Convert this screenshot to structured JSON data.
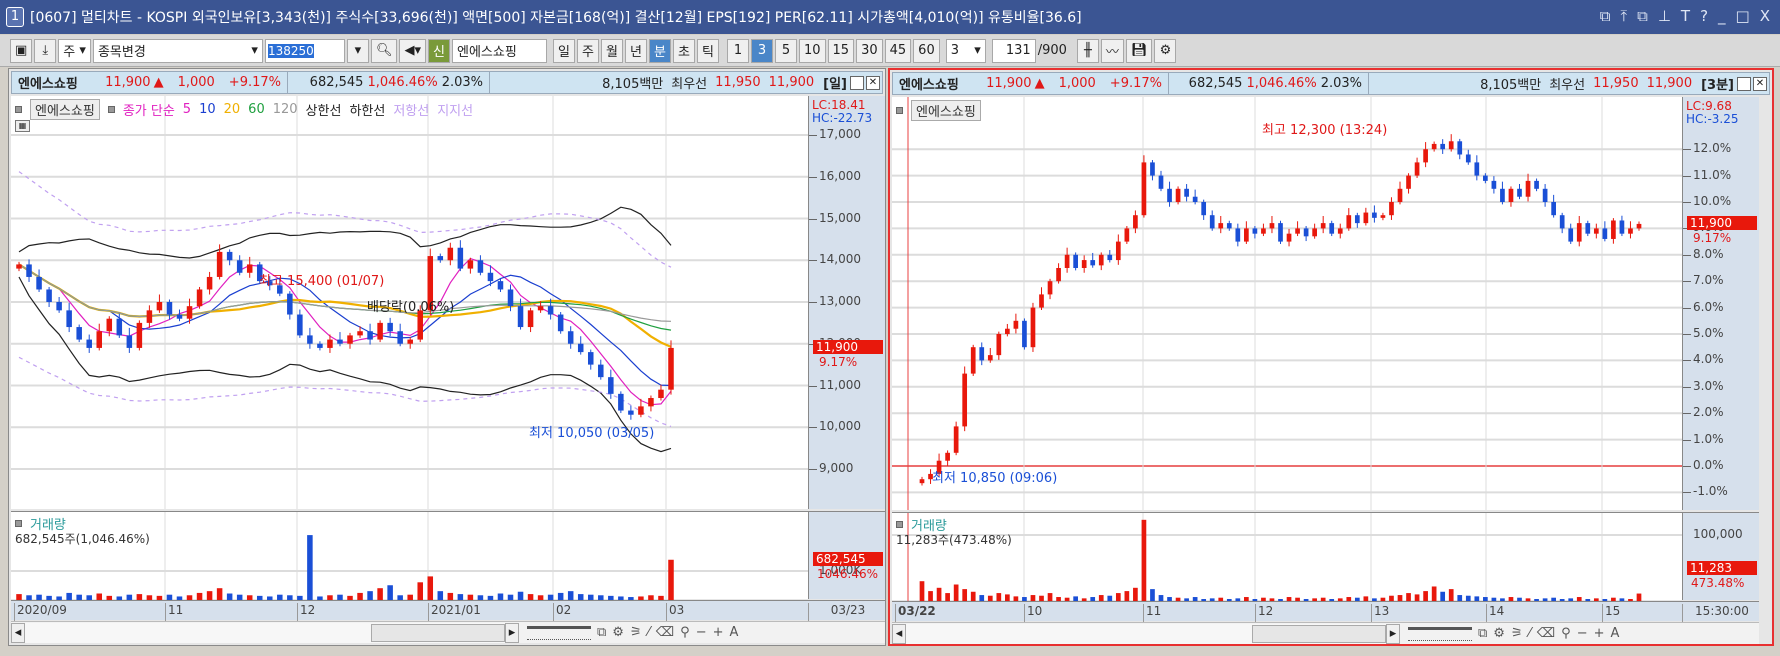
{
  "window": {
    "number": "1",
    "title": "[0607] 멀티차트 - KOSPI 외국인보유[3,343(천)] 주식수[33,696(천)] 액면[500] 자본금[168(억)] 결산[12월] EPS[192] PER[62.11] 시가총액[4,010(억)] 유통비율[36.6]",
    "controls": [
      "⧉",
      "⤒",
      "⧉",
      "⊥",
      "T",
      "?",
      "_",
      "□",
      "X"
    ]
  },
  "toolbar": {
    "market": "주",
    "stock_change": "종목변경",
    "code": "138250",
    "badge": "신",
    "stock_name": "엔에스쇼핑",
    "periods": [
      "일",
      "주",
      "월",
      "년",
      "분",
      "초",
      "틱"
    ],
    "active_period": "분",
    "intervals": [
      "1",
      "3",
      "5",
      "10",
      "15",
      "30",
      "45",
      "60"
    ],
    "active_interval": "3",
    "count_select": "3",
    "display_count": "131",
    "total": "/900"
  },
  "colors": {
    "up": "#e8180c",
    "down": "#1a4fd6",
    "title_bar": "#3b5593",
    "axis_bg": "#d6e0ec"
  },
  "left": {
    "info": {
      "name": "엔에스쇼핑",
      "price": "11,900",
      "arrow": "▲",
      "change": "1,000",
      "change_pct": "+9.17%",
      "volume": "682,545",
      "volume_pct": "1,046.46%",
      "turnover": "2.03%",
      "amount": "8,105백만",
      "best_label": "최우선",
      "ask": "11,950",
      "bid": "11,900",
      "period": "[일]"
    },
    "legend": {
      "stock": "엔에스쇼핑",
      "items": [
        {
          "t": "종가 단순",
          "c": "#e020c0"
        },
        {
          "t": "5",
          "c": "#e020c0"
        },
        {
          "t": "10",
          "c": "#1a3fd0"
        },
        {
          "t": "20",
          "c": "#f0b000"
        },
        {
          "t": "60",
          "c": "#20a040"
        },
        {
          "t": "120",
          "c": "#999999"
        },
        {
          "t": "상한선",
          "c": "#222222"
        },
        {
          "t": "하한선",
          "c": "#222222"
        },
        {
          "t": "저항선",
          "c": "#c0a0f0"
        },
        {
          "t": "지지선",
          "c": "#c0a0f0"
        }
      ]
    },
    "lc": "LC:18.41",
    "hc": "HC:-22.73",
    "y_ticks": [
      "17,000",
      "16,000",
      "15,000",
      "14,000",
      "13,000",
      "12,000",
      "11,000",
      "10,000",
      "9,000"
    ],
    "last_price": "11,900",
    "last_pct": "9.17%",
    "annotations": {
      "high": "최고 15,400 (01/07)",
      "low": "최저 10,050 (03/05)",
      "dividend": "배당락(0.06%)"
    },
    "volume": {
      "title": "거래량",
      "summary": "682,545주(1,046.46%)",
      "tick": "1,000K",
      "last": "682,545",
      "last_pct": "1046.46%"
    },
    "x_labels": [
      "2020/09",
      "11",
      "12",
      "2021/01",
      "02",
      "03"
    ],
    "x_last": "03/23",
    "closes": [
      13900,
      13600,
      13300,
      13000,
      12800,
      12400,
      12100,
      11900,
      12300,
      12600,
      12200,
      11900,
      12500,
      12800,
      13000,
      12700,
      12600,
      12900,
      13300,
      13600,
      14200,
      14000,
      13700,
      13900,
      13500,
      13400,
      13200,
      12700,
      12200,
      12000,
      11900,
      12100,
      12000,
      12200,
      12300,
      12100,
      12500,
      12300,
      12000,
      12100,
      12800,
      14100,
      14000,
      14300,
      13800,
      14000,
      13700,
      13500,
      13300,
      12900,
      12400,
      12800,
      12900,
      12700,
      12300,
      12000,
      11800,
      11500,
      11200,
      10800,
      10400,
      10300,
      10500,
      10700,
      10900,
      11900
    ],
    "volumes_k": [
      100,
      80,
      90,
      70,
      60,
      120,
      90,
      80,
      110,
      70,
      60,
      90,
      100,
      80,
      70,
      90,
      60,
      80,
      120,
      150,
      200,
      110,
      90,
      80,
      70,
      60,
      90,
      80,
      70,
      1100,
      60,
      80,
      90,
      70,
      120,
      150,
      200,
      250,
      80,
      90,
      300,
      400,
      150,
      120,
      100,
      90,
      80,
      70,
      110,
      90,
      140,
      100,
      80,
      90,
      120,
      150,
      100,
      90,
      80,
      70,
      60,
      50,
      60,
      80,
      70,
      682
    ]
  },
  "right": {
    "info": {
      "name": "엔에스쇼핑",
      "price": "11,900",
      "arrow": "▲",
      "change": "1,000",
      "change_pct": "+9.17%",
      "volume": "682,545",
      "volume_pct": "1,046.46%",
      "turnover": "2.03%",
      "amount": "8,105백만",
      "best_label": "최우선",
      "ask": "11,950",
      "bid": "11,900",
      "period": "[3분]"
    },
    "legend": {
      "stock": "엔에스쇼핑"
    },
    "lc": "LC:9.68",
    "hc": "HC:-3.25",
    "y_ticks": [
      "12.0%",
      "11.0%",
      "10.0%",
      "9.0%",
      "8.0%",
      "7.0%",
      "6.0%",
      "5.0%",
      "4.0%",
      "3.0%",
      "2.0%",
      "1.0%",
      "0.0%",
      "-1.0%"
    ],
    "last_price": "11,900",
    "last_pct": "9.17%",
    "annotations": {
      "high": "최고 12,300 (13:24)",
      "low": "최저 10,850 (09:06)"
    },
    "volume": {
      "title": "거래량",
      "summary": "11,283주(473.48%)",
      "tick": "100,000",
      "last": "11,283",
      "last_pct": "473.48%"
    },
    "x_labels": [
      "03/22",
      "10",
      "11",
      "12",
      "13",
      "14",
      "15"
    ],
    "x_last": "15:30:00",
    "closes_pct": [
      -0.5,
      -0.3,
      0.2,
      0.5,
      1.5,
      3.5,
      4.5,
      4.0,
      4.2,
      5.0,
      5.2,
      5.5,
      4.5,
      6.0,
      6.5,
      7.0,
      7.5,
      8.0,
      7.5,
      7.8,
      7.6,
      8.0,
      7.8,
      8.5,
      9.0,
      9.5,
      11.5,
      11.0,
      10.5,
      10.0,
      10.5,
      10.2,
      10.0,
      9.5,
      9.0,
      9.2,
      9.0,
      8.5,
      9.0,
      8.8,
      9.0,
      9.2,
      8.5,
      8.8,
      9.0,
      8.7,
      9.0,
      9.2,
      8.8,
      9.0,
      9.5,
      9.2,
      9.6,
      9.4,
      9.5,
      10.0,
      10.5,
      11.0,
      11.5,
      12.0,
      12.2,
      12.0,
      12.3,
      11.8,
      11.5,
      11.0,
      10.8,
      10.5,
      10.0,
      10.5,
      10.2,
      10.8,
      10.5,
      10.0,
      9.5,
      9.0,
      8.5,
      9.2,
      8.8,
      9.0,
      8.6,
      9.3,
      8.8,
      9.0,
      9.17
    ],
    "volumes": [
      30000,
      15000,
      20000,
      12000,
      25000,
      18000,
      14000,
      9000,
      8000,
      12000,
      10000,
      7000,
      6000,
      9000,
      8000,
      12000,
      6000,
      5000,
      7000,
      4000,
      6000,
      9000,
      8000,
      12000,
      15000,
      20000,
      123000,
      18000,
      9000,
      6000,
      5000,
      4000,
      6000,
      3000,
      4000,
      5000,
      3000,
      4000,
      6000,
      3000,
      5000,
      4000,
      3000,
      6000,
      5000,
      3000,
      4000,
      5000,
      3000,
      4000,
      6000,
      5000,
      7000,
      4000,
      5000,
      8000,
      9000,
      12000,
      10000,
      15000,
      22000,
      14000,
      18000,
      9000,
      8000,
      7000,
      6000,
      5000,
      4000,
      6000,
      5000,
      4000,
      3000,
      4000,
      5000,
      3000,
      4000,
      6000,
      3000,
      4000,
      3000,
      5000,
      4000,
      3000,
      11283
    ]
  }
}
